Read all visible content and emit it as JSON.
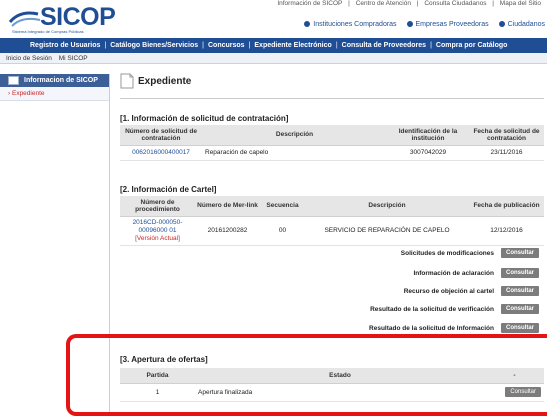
{
  "header": {
    "logo_text": "SICOP",
    "logo_sub": "Sistema Integrado de Compras Públicas",
    "top_links": [
      "Información de SICOP",
      "|",
      "Centro de Atención",
      "|",
      "Consulta Ciudadanos",
      "|",
      "Mapa del Sitio"
    ],
    "shortcuts": [
      "Instituciones Compradoras",
      "Empresas Proveedoras",
      "Ciudadanos"
    ]
  },
  "nav": {
    "items": [
      "Registro de Usuarios",
      "Catálogo Bienes/Servicios",
      "Concursos",
      "Expediente Electrónico",
      "Consulta de Proveedores",
      "Compra por Catálogo"
    ]
  },
  "subnav": {
    "items": [
      "Inicio de Sesión",
      "Mi SICOP"
    ]
  },
  "sidebar": {
    "title": "Informacion de SICOP",
    "items": [
      "Expediente"
    ]
  },
  "page": {
    "title": "Expediente"
  },
  "section1": {
    "title": "[1. Información de solicitud de contratación]",
    "headers": [
      "Número de solicitud de contratación",
      "Descripción",
      "Identificación de la institución",
      "Fecha de solicitud de contratación"
    ],
    "row": [
      "0062016000400017",
      "Reparación de capelo",
      "3007042029",
      "23/11/2016"
    ]
  },
  "section2": {
    "title": "[2. Información de Cartel]",
    "headers": [
      "Número de procedimiento",
      "Número de Mer-link",
      "Secuencia",
      "Descripción",
      "Fecha de publicación"
    ],
    "row": {
      "procedimiento": "2016CD-000050-00096000 01",
      "version": "[Versión Actual]",
      "merlink": "20161200282",
      "secuencia": "00",
      "descripcion": "SERVICIO DE REPARACIÓN DE CAPELO",
      "fecha": "12/12/2016"
    },
    "extras": [
      "Solicitudes de modificaciones",
      "Información de aclaración",
      "Recurso de objeción al cartel",
      "Resultado de la solicitud de verificación",
      "Resultado de la solicitud de Información"
    ],
    "button_label": "Consultar"
  },
  "section3": {
    "title": "[3. Apertura de ofertas]",
    "headers": [
      "Partida",
      "Estado",
      "-"
    ],
    "row": [
      "1",
      "Apertura finalizada"
    ],
    "button_label": "Consultar"
  }
}
